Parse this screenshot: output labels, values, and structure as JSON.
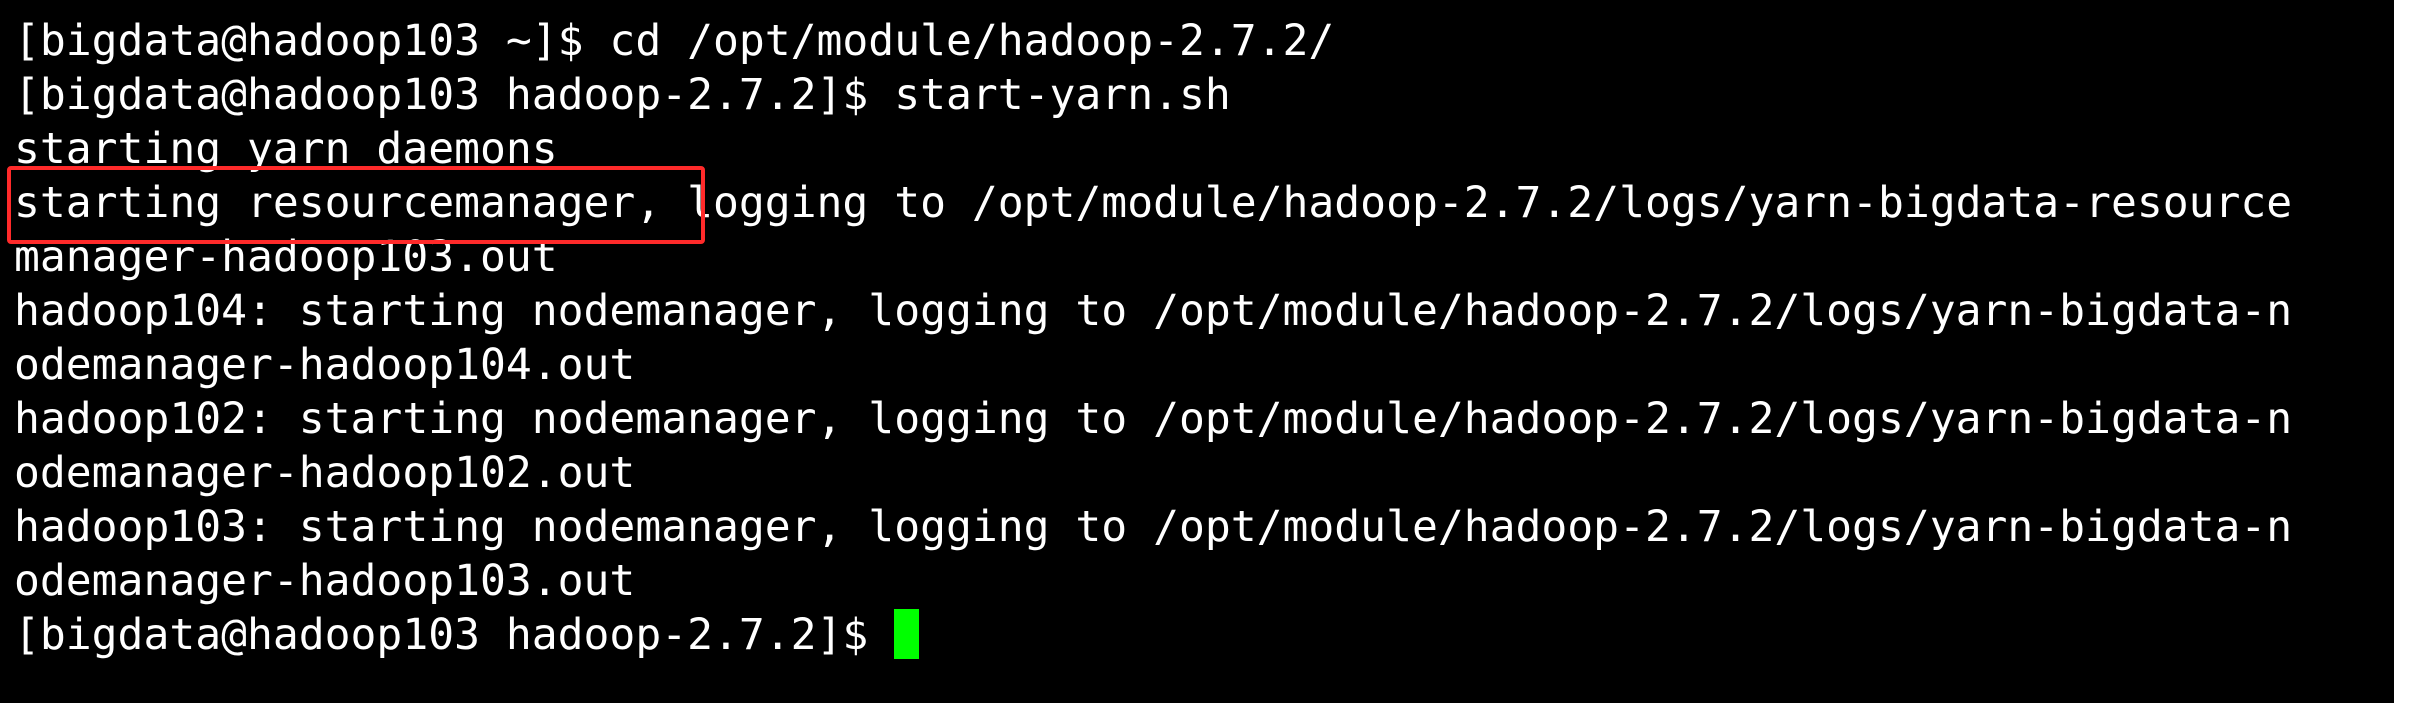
{
  "terminal": {
    "lines": [
      "[bigdata@hadoop103 ~]$ cd /opt/module/hadoop-2.7.2/",
      "[bigdata@hadoop103 hadoop-2.7.2]$ start-yarn.sh",
      "starting yarn daemons",
      "starting resourcemanager, logging to /opt/module/hadoop-2.7.2/logs/yarn-bigdata-resource",
      "manager-hadoop103.out",
      "hadoop104: starting nodemanager, logging to /opt/module/hadoop-2.7.2/logs/yarn-bigdata-n",
      "odemanager-hadoop104.out",
      "hadoop102: starting nodemanager, logging to /opt/module/hadoop-2.7.2/logs/yarn-bigdata-n",
      "odemanager-hadoop102.out",
      "hadoop103: starting nodemanager, logging to /opt/module/hadoop-2.7.2/logs/yarn-bigdata-n",
      "odemanager-hadoop103.out"
    ],
    "prompt": "[bigdata@hadoop103 hadoop-2.7.2]$"
  },
  "colors": {
    "background": "#000000",
    "text": "#ffffff",
    "cursor": "#00ff00",
    "highlight": "#ff2a2a"
  }
}
